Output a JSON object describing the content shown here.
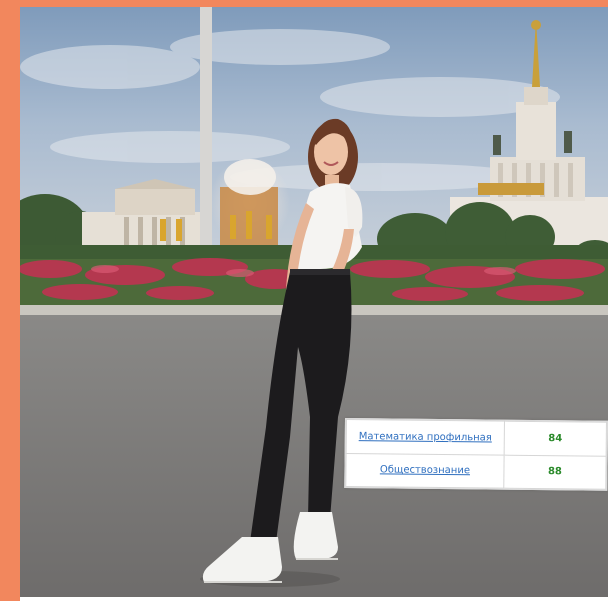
{
  "colors": {
    "frame_accent": "#f2875d",
    "sky": "#8fa7c2",
    "asphalt": "#7d7b7a",
    "flowers": "#b4384f",
    "link": "#2f6fbf",
    "score": "#2a8a2a"
  },
  "scores": [
    {
      "subject": "Математика профильная",
      "score": "84"
    },
    {
      "subject": "Обществознание",
      "score": "88"
    }
  ]
}
